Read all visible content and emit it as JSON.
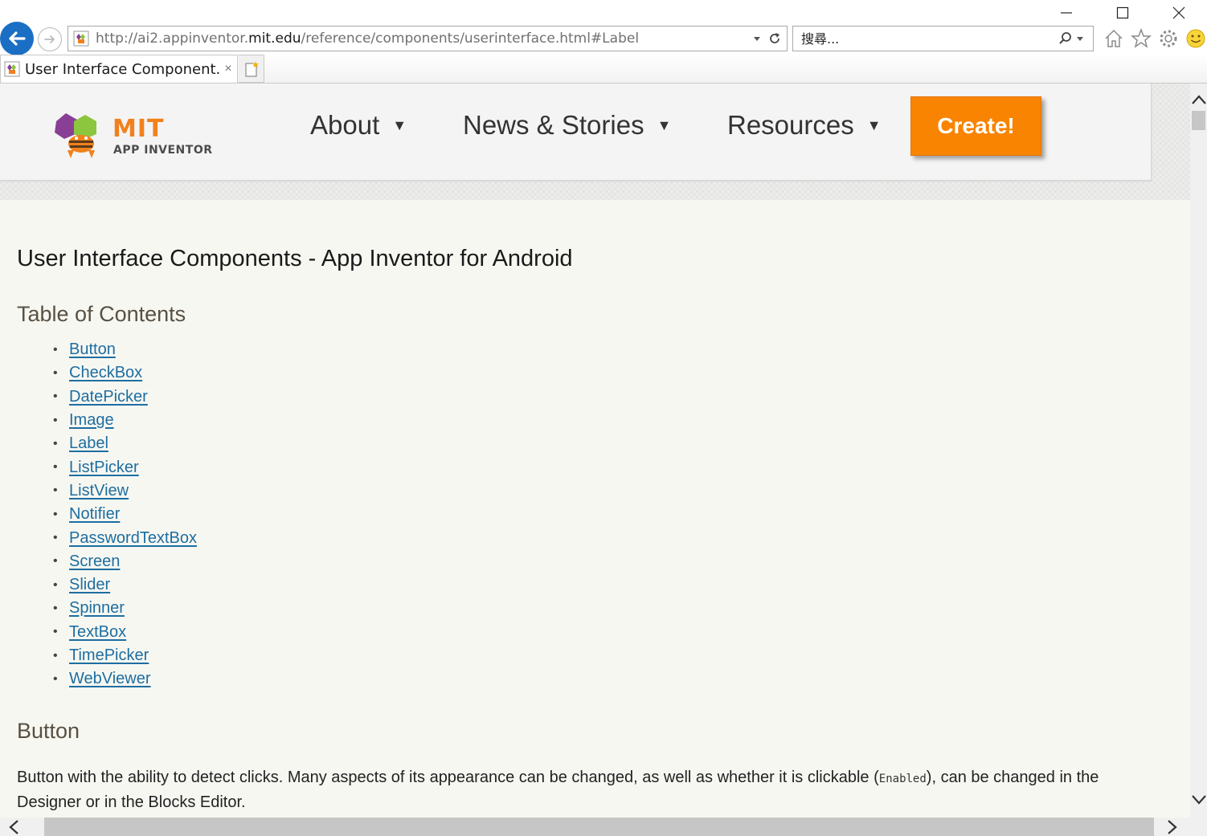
{
  "browser": {
    "address_url_prefix": "http://ai2.appinventor.",
    "address_url_domain": "mit.edu",
    "address_url_suffix": "/reference/components/userinterface.html#Label",
    "search_placeholder": "搜尋...",
    "tab_title": "User Interface Component...",
    "tab_close": "×",
    "icons": [
      "back-icon",
      "forward-icon",
      "dropdown-icon",
      "refresh-icon",
      "search-icon",
      "home-icon",
      "favorites-star-icon",
      "settings-gear-icon",
      "smiley-feedback-icon"
    ]
  },
  "site": {
    "logo_mit": "MIT",
    "logo_sub": "APP INVENTOR",
    "nav": [
      {
        "label": "About",
        "caret": "▼"
      },
      {
        "label": "News & Stories",
        "caret": "▼"
      },
      {
        "label": "Resources",
        "caret": "▼"
      }
    ],
    "create_label": "Create!",
    "accent_color": "#f88402",
    "link_color": "#1d6ea0"
  },
  "content": {
    "page_title": "User Interface Components - App Inventor for Android",
    "toc_title": "Table of Contents",
    "toc": [
      "Button",
      "CheckBox",
      "DatePicker",
      "Image",
      "Label",
      "ListPicker",
      "ListView",
      "Notifier",
      "PasswordTextBox",
      "Screen",
      "Slider",
      "Spinner",
      "TextBox",
      "TimePicker",
      "WebViewer"
    ],
    "section_title": "Button",
    "para_1": "Button with the ability to detect clicks. Many aspects of its appearance can be changed, as well as whether it is clickable (",
    "para_code": "Enabled",
    "para_2": "), can be changed in the Designer or in the Blocks Editor."
  }
}
